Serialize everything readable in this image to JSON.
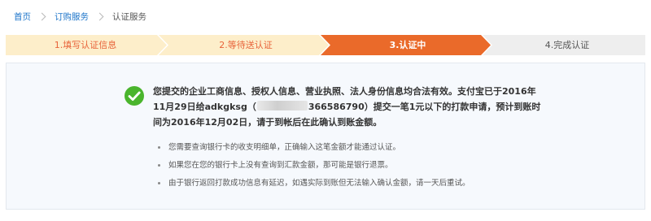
{
  "breadcrumb": {
    "home": "首页",
    "orders": "订购服务",
    "current": "认证服务"
  },
  "steps": [
    {
      "label": "1.填写认证信息",
      "state": "done"
    },
    {
      "label": "2.等待送认证",
      "state": "done"
    },
    {
      "label": "3.认证中",
      "state": "active"
    },
    {
      "label": "4.完成认证",
      "state": "pending"
    }
  ],
  "colors": {
    "step_done_fill": "#fdeeca",
    "step_done_text": "#e8633a",
    "step_active_fill": "#ea6a2a",
    "step_active_text": "#ffffff",
    "step_pending_fill": "#eeeeee",
    "step_pending_text": "#555555",
    "success_green": "#4ab52d"
  },
  "result": {
    "icon": "check-circle-icon",
    "message_part1": "您提交的企业工商信息、授权人信息、营业执照、法人身份信息均合法有效。支付宝已于2016年11月29日给adkgksg（",
    "message_part2": "366586790）提交一笔1元以下的打款申请，预计到账时间为2016年12月02日，请于到帐后在此确认到账金额。",
    "notes": [
      "您需要查询银行卡的收支明细单，正确输入这笔金额才能通过认证。",
      "如果您在您的银行卡上没有查询到汇款金额，那可能是银行退票。",
      "由于银行返回打款成功信息有延迟，如遇实际到账但无法输入确认金额，请一天后重试。"
    ]
  }
}
